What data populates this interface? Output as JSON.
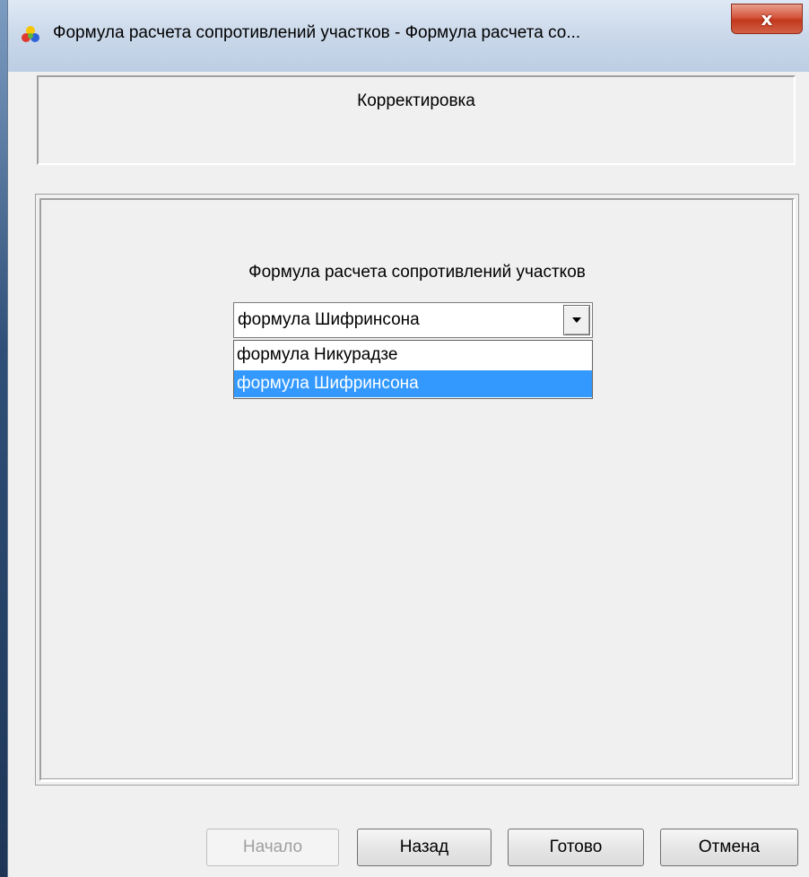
{
  "window": {
    "title": "Формула расчета сопротивлений участков - Формула расчета со...",
    "close_label": "x"
  },
  "header": {
    "title": "Корректировка"
  },
  "form": {
    "label": "Формула расчета сопротивлений участков",
    "combo_value": "формула Шифринсона",
    "options": [
      {
        "label": "формула Никурадзе",
        "selected": false
      },
      {
        "label": "формула Шифринсона",
        "selected": true
      }
    ]
  },
  "buttons": {
    "start": "Начало",
    "back": "Назад",
    "finish": "Готово",
    "cancel": "Отмена"
  },
  "colors": {
    "selection": "#3399ff",
    "disabled_text": "#a0a0a0"
  }
}
